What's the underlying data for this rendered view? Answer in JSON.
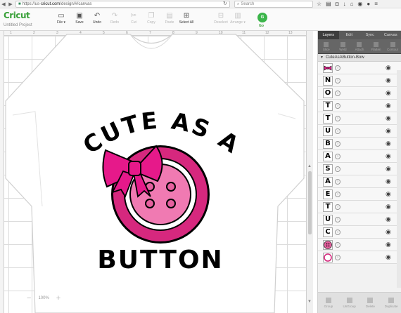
{
  "browser": {
    "url_prefix": "https://us-",
    "url_host": "cricut.com",
    "url_suffix": "/design/#/canvas",
    "search_placeholder": "Search"
  },
  "app": {
    "logo": "Cricut",
    "project_name": "Untitled Project",
    "toolbar": [
      {
        "name": "file",
        "label": "File ▾",
        "icon": "folder-icon",
        "enabled": true
      },
      {
        "name": "save",
        "label": "Save",
        "icon": "save-icon",
        "enabled": true
      },
      {
        "name": "undo",
        "label": "Undo",
        "icon": "undo-icon",
        "enabled": true
      },
      {
        "name": "redo",
        "label": "Redo",
        "icon": "redo-icon",
        "enabled": false
      },
      {
        "name": "cut",
        "label": "Cut",
        "icon": "cut-icon",
        "enabled": false
      },
      {
        "name": "copy",
        "label": "Copy",
        "icon": "copy-icon",
        "enabled": false
      },
      {
        "name": "paste",
        "label": "Paste",
        "icon": "paste-icon",
        "enabled": false
      },
      {
        "name": "select-all",
        "label": "Select All",
        "icon": "select-all-icon",
        "enabled": true
      },
      {
        "name": "deselect",
        "label": "Deselect",
        "icon": "deselect-icon",
        "enabled": false
      },
      {
        "name": "arrange",
        "label": "Arrange ▾",
        "icon": "arrange-icon",
        "enabled": false
      },
      {
        "name": "align",
        "label": "Align ▾",
        "icon": "align-icon",
        "enabled": false
      }
    ],
    "go_label": "Go",
    "go_color": "#3bb54a"
  },
  "canvas": {
    "ruler_numbers": [
      "1",
      "2",
      "3",
      "4",
      "5",
      "6",
      "7",
      "8",
      "9",
      "10",
      "11",
      "12",
      "13"
    ],
    "zoom": "100%",
    "design_text_top": "CUTE AS A",
    "design_text_bottom": "BUTTON",
    "colors": {
      "pink_dark": "#d6287e",
      "pink_mid": "#e6609f",
      "pink_light": "#f07ab2",
      "bow": "#e6198a"
    }
  },
  "panel": {
    "tabs": [
      "Layers",
      "Edit",
      "Sync",
      "Canvas"
    ],
    "active_tab": "Layers",
    "actions": [
      "Slice",
      "Weld",
      "Attach",
      "Flatten",
      "Contour"
    ],
    "group_name": "CuteAsAButton-Bow",
    "layers": [
      {
        "kind": "bow",
        "glyph": ""
      },
      {
        "kind": "letter",
        "glyph": "N"
      },
      {
        "kind": "letter",
        "glyph": "O"
      },
      {
        "kind": "letter",
        "glyph": "T"
      },
      {
        "kind": "letter",
        "glyph": "T"
      },
      {
        "kind": "letter",
        "glyph": "U"
      },
      {
        "kind": "letter",
        "glyph": "B"
      },
      {
        "kind": "letter",
        "glyph": "A"
      },
      {
        "kind": "letter",
        "glyph": "S"
      },
      {
        "kind": "letter",
        "glyph": "A"
      },
      {
        "kind": "letter",
        "glyph": "E"
      },
      {
        "kind": "letter",
        "glyph": "T"
      },
      {
        "kind": "letter",
        "glyph": "U"
      },
      {
        "kind": "letter",
        "glyph": "C"
      },
      {
        "kind": "button",
        "glyph": ""
      },
      {
        "kind": "ring",
        "glyph": ""
      }
    ],
    "footer": [
      "Group",
      "UnGroup",
      "Delete",
      "Duplicate"
    ]
  }
}
